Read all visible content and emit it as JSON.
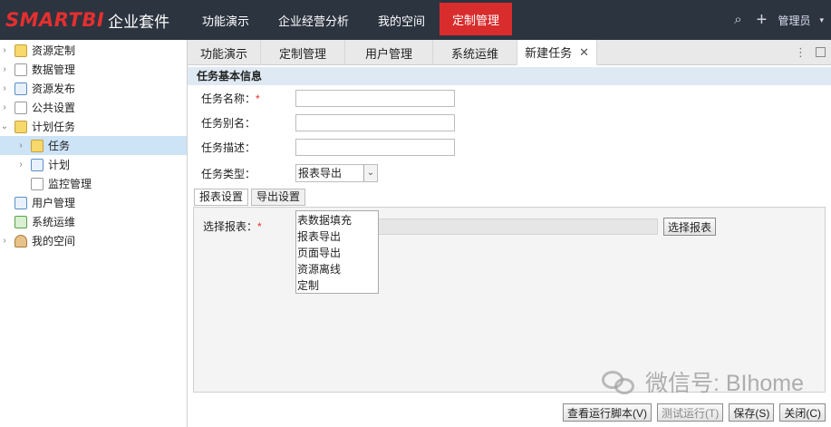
{
  "brand": {
    "logo": "SMARTBI",
    "suite": "企业套件"
  },
  "topnav": [
    {
      "label": "功能演示"
    },
    {
      "label": "企业经营分析"
    },
    {
      "label": "我的空间"
    },
    {
      "label": "定制管理"
    }
  ],
  "topright": {
    "user": "管理员"
  },
  "sidebar": {
    "items": [
      {
        "label": "资源定制"
      },
      {
        "label": "数据管理"
      },
      {
        "label": "资源发布"
      },
      {
        "label": "公共设置"
      },
      {
        "label": "计划任务"
      },
      {
        "label": "任务"
      },
      {
        "label": "计划"
      },
      {
        "label": "监控管理"
      },
      {
        "label": "用户管理"
      },
      {
        "label": "系统运维"
      },
      {
        "label": "我的空间"
      }
    ]
  },
  "tabs": [
    {
      "label": "功能演示"
    },
    {
      "label": "定制管理"
    },
    {
      "label": "用户管理"
    },
    {
      "label": "系统运维"
    },
    {
      "label": "新建任务"
    }
  ],
  "form": {
    "section_title": "任务基本信息",
    "name_label": "任务名称：",
    "alias_label": "任务别名：",
    "desc_label": "任务描述：",
    "type_label": "任务类型：",
    "type_value": "报表导出",
    "type_options": [
      "表数据填充",
      "报表导出",
      "页面导出",
      "资源离线",
      "定制"
    ]
  },
  "subtabs": [
    "报表设置",
    "导出设置"
  ],
  "panel": {
    "choose_label": "选择报表：",
    "choose_button": "选择报表"
  },
  "buttons": {
    "view_script": "查看运行脚本(V)",
    "test_run": "测试运行(T)",
    "save": "保存(S)",
    "close": "关闭(C)"
  },
  "watermark": "微信号: BIhome",
  "colors": {
    "topbar": "#2c3440",
    "accent": "#d92d2d",
    "selected": "#cde3f6",
    "section": "#dfe9f3"
  }
}
